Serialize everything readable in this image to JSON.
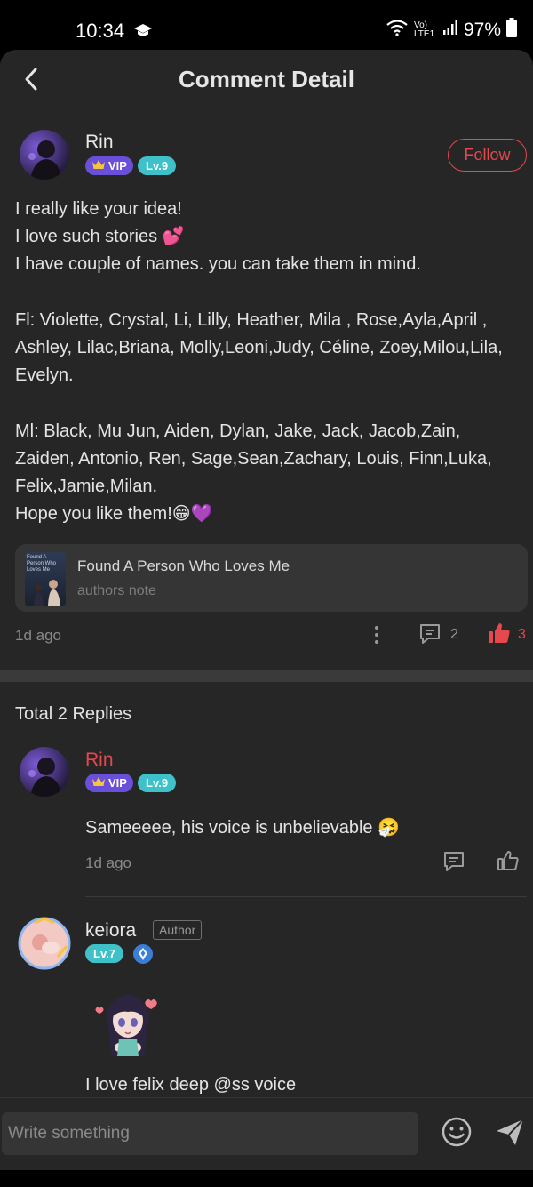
{
  "status_bar": {
    "time": "10:34",
    "network": "Vo) LTE1",
    "battery": "97%"
  },
  "header": {
    "title": "Comment Detail"
  },
  "post": {
    "author": "Rin",
    "vip_label": "VIP",
    "level": "Lv.9",
    "follow_label": "Follow",
    "lines": [
      "I really like your idea!",
      "I love such stories 💕",
      "I have couple of names. you can take them in mind.",
      "",
      "Fl: Violette,  Crystal,  Li, Lilly,  Heather, Mila , Rose,Ayla,April ,",
      "Ashley, Lilac,Briana, Molly,Leoni,Judy, Céline, Zoey,Milou,Lila,",
      "Evelyn.",
      "",
      "Ml: Black, Mu Jun, Aiden, Dylan, Jake, Jack, Jacob,Zain,",
      "Zaiden, Antonio, Ren, Sage,Sean,Zachary, Louis, Finn,Luka,",
      "Felix,Jamie,Milan.",
      "Hope you like them!😁💜"
    ],
    "book": {
      "cover_text": "Found A Person Who Loves Me",
      "title": "Found A Person Who Loves Me",
      "subtitle": "authors note"
    },
    "time": "1d ago",
    "comment_count": "2",
    "like_count": "3"
  },
  "replies": {
    "total_label": "Total 2 Replies",
    "items": [
      {
        "name": "Rin",
        "vip_label": "VIP",
        "level": "Lv.9",
        "text": "Sameeeee, his voice is unbelievable 🤧",
        "time": "1d ago"
      },
      {
        "name": "keiora",
        "author_tag": "Author",
        "level": "Lv.7",
        "text": "I love felix deep @ss voice"
      }
    ]
  },
  "composer": {
    "placeholder": "Write something"
  },
  "colors": {
    "background": "#262626",
    "accent_red": "#e5484d",
    "vip_purple": "#6a4fd8",
    "level_teal": "#3ec1c9"
  }
}
